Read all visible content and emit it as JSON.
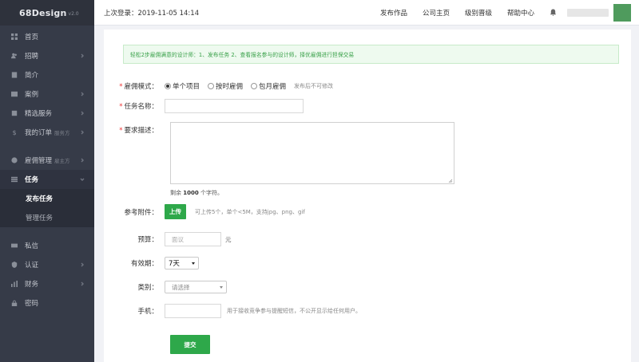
{
  "app": {
    "brand": "68Design",
    "version": "v2.0"
  },
  "sidebar": {
    "items": [
      {
        "label": "首页",
        "icon": "dashboard-icon"
      },
      {
        "label": "招聘",
        "icon": "recruit-icon"
      },
      {
        "label": "简介",
        "icon": "profile-icon"
      },
      {
        "label": "案例",
        "icon": "cases-icon"
      },
      {
        "label": "精选服务",
        "icon": "service-icon"
      },
      {
        "label": "我的订单",
        "tag": "服务方",
        "icon": "yuan-icon"
      },
      {
        "label": "雇佣管理",
        "tag": "雇主方",
        "icon": "employ-icon"
      },
      {
        "label": "任务",
        "icon": "task-icon"
      },
      {
        "label": "私信",
        "icon": "mail-icon"
      },
      {
        "label": "认证",
        "icon": "verify-icon"
      },
      {
        "label": "财务",
        "icon": "finance-icon"
      },
      {
        "label": "密码",
        "icon": "lock-icon"
      }
    ],
    "sub_items": [
      {
        "label": "发布任务"
      },
      {
        "label": "管理任务"
      }
    ]
  },
  "header": {
    "last_login": "上次登录：2019-11-05 14:14",
    "links": [
      "发布作品",
      "公司主页",
      "级别晋级",
      "帮助中心"
    ]
  },
  "notice": "轻松2步雇佣满意的设计师：1、发布任务   2、查看报名参与的设计师，择优雇佣进行担保交易",
  "form": {
    "mode": {
      "label": "雇佣模式：",
      "options": [
        "单个项目",
        "按时雇佣",
        "包月雇佣"
      ],
      "selected_index": 0,
      "hint": "发布后不可修改"
    },
    "task_name": {
      "label": "任务名称："
    },
    "description": {
      "label": "要求描述：",
      "remain_prefix": "剩余",
      "remain_count": "1000",
      "remain_suffix": "个字符。"
    },
    "attachment": {
      "label": "参考附件：",
      "button": "上传",
      "hint": "可上传5个，单个<5M，支持jpg、png、gif"
    },
    "budget": {
      "label": "预算：",
      "placeholder": "面议",
      "unit": "元"
    },
    "validity": {
      "label": "有效期：",
      "value": "7天"
    },
    "category": {
      "label": "类别：",
      "value": "请选择"
    },
    "phone": {
      "label": "手机：",
      "hint": "用于接收竞争参与提醒短信，不公开显示给任何用户。"
    },
    "submit": "提交"
  },
  "colors": {
    "sidebar_bg": "#363b48",
    "accent_green": "#2ea84a",
    "notice_text": "#3aa14a",
    "required": "#e33333"
  }
}
